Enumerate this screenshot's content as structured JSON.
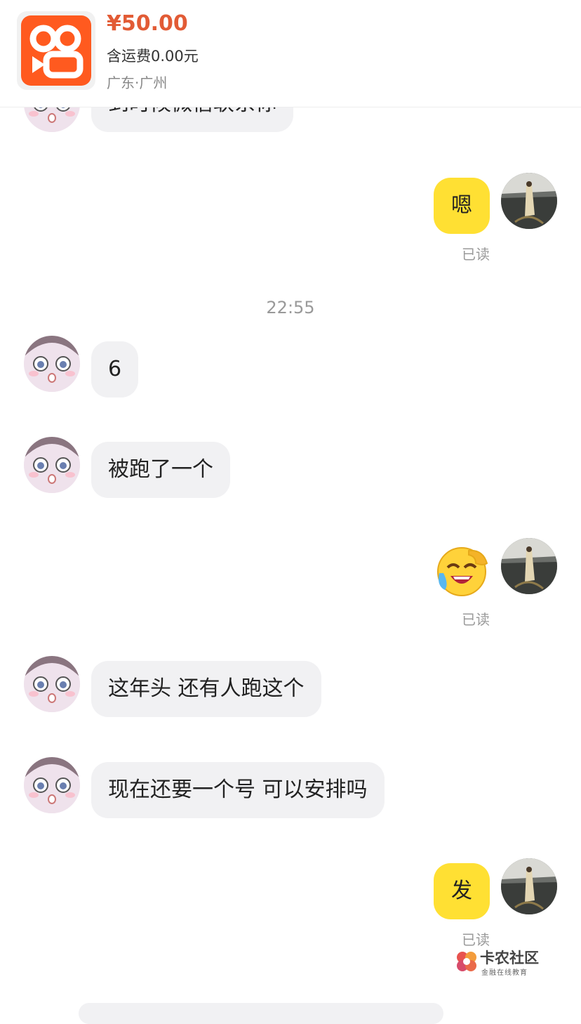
{
  "product": {
    "price": "¥50.00",
    "shipping": "含运费0.00元",
    "location": "广东·广州"
  },
  "messages": [
    {
      "side": "left",
      "text": "到时候微信联系你"
    },
    {
      "side": "right",
      "text": "嗯",
      "status": "已读"
    },
    {
      "side": "timestamp",
      "text": "22:55"
    },
    {
      "side": "left",
      "text": "6"
    },
    {
      "side": "left",
      "text": "被跑了一个"
    },
    {
      "side": "right",
      "emoji": "laughing-crying-emoji",
      "status": "已读"
    },
    {
      "side": "left",
      "text": "这年头 还有人跑这个"
    },
    {
      "side": "left",
      "text": "现在还要一个号 可以安排吗"
    },
    {
      "side": "right",
      "text": "发",
      "status": "已读"
    }
  ],
  "watermark": {
    "title": "卡农社区",
    "subtitle": "金融在线教育"
  },
  "colors": {
    "price": "#e25b35",
    "my_bubble": "#ffe033",
    "their_bubble": "#f1f1f3",
    "logo": "#ff5a1f"
  }
}
